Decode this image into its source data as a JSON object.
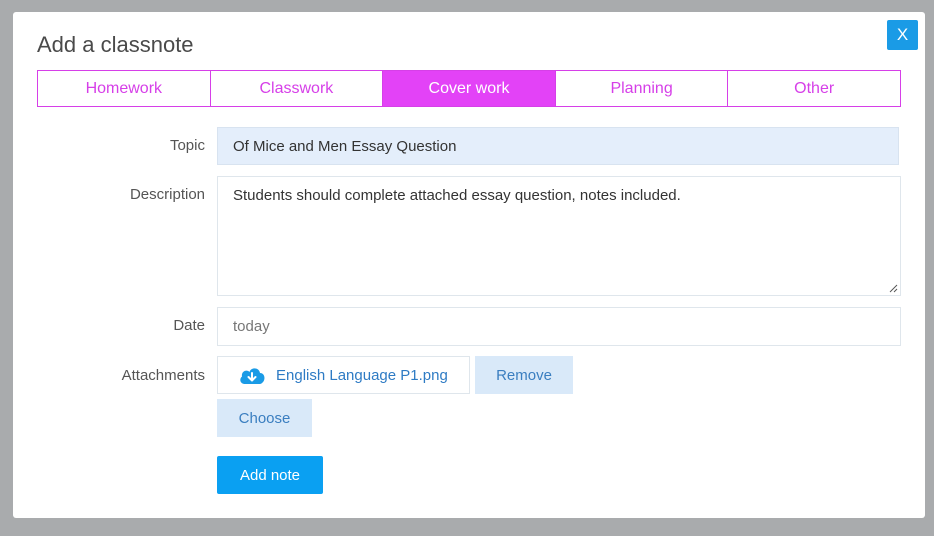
{
  "modal": {
    "title": "Add a classnote",
    "close_label": "X"
  },
  "tabs": [
    {
      "label": "Homework",
      "active": false
    },
    {
      "label": "Classwork",
      "active": false
    },
    {
      "label": "Cover work",
      "active": true
    },
    {
      "label": "Planning",
      "active": false
    },
    {
      "label": "Other",
      "active": false
    }
  ],
  "form": {
    "topic_label": "Topic",
    "topic_value": "Of Mice and Men Essay Question",
    "description_label": "Description",
    "description_value": "Students should complete attached essay question, notes included.",
    "date_label": "Date",
    "date_placeholder": "today",
    "attachments_label": "Attachments",
    "attachment_filename": "English Language P1.png",
    "attachment_icon": "cloud-download-icon",
    "remove_label": "Remove",
    "choose_label": "Choose",
    "submit_label": "Add note"
  },
  "colors": {
    "accent_magenta": "#e342f7",
    "primary_blue": "#0aa0f2",
    "light_blue": "#d9e9f9"
  }
}
